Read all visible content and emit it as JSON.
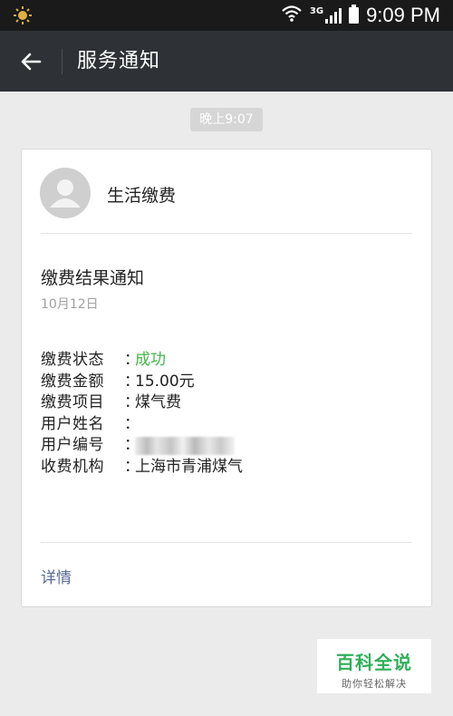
{
  "status_bar": {
    "time": "9:09 PM",
    "network": "3G",
    "icons": [
      "weather-sun-icon",
      "wifi-icon",
      "signal-icon",
      "battery-icon"
    ]
  },
  "title_bar": {
    "title": "服务通知",
    "back_icon": "arrow-left-icon"
  },
  "message": {
    "timestamp": "晚上9:07",
    "sender": "生活缴费",
    "title": "缴费结果通知",
    "date": "10月12日",
    "fields": [
      {
        "label": "缴费状态",
        "colon": "：",
        "value": "成功"
      },
      {
        "label": "缴费金额",
        "colon": "：",
        "value": "15.00元"
      },
      {
        "label": "缴费项目",
        "colon": "：",
        "value": "煤气费"
      },
      {
        "label": "用户姓名",
        "colon": "：",
        "value": ""
      },
      {
        "label": "用户编号",
        "colon": "：",
        "value": ""
      },
      {
        "label": "收费机构",
        "colon": "：",
        "value": "上海市青浦煤气"
      }
    ],
    "detail_link": "详情",
    "success_color": "#44b549",
    "link_color": "#576b95"
  },
  "watermark": {
    "main": "百科全说",
    "sub": "助你轻松解决"
  }
}
